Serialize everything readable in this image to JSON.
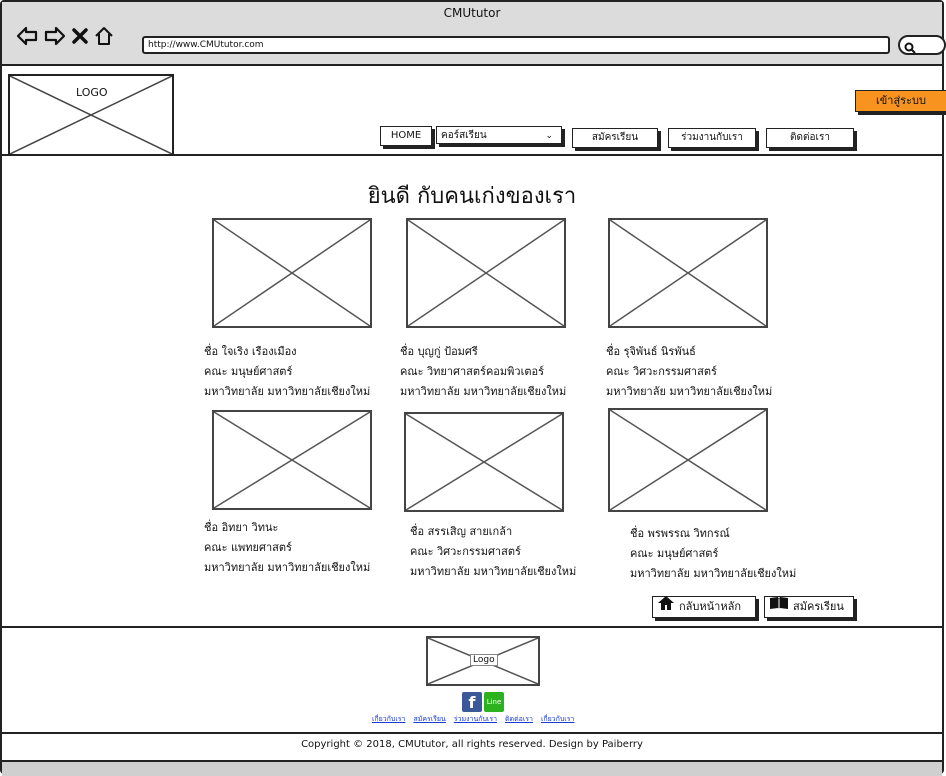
{
  "window": {
    "title": "CMUtutor",
    "url": "http://www.CMUtutor.com"
  },
  "header": {
    "logo_label": "LOGO",
    "login_label": "เข้าสู่ระบบ",
    "menu": {
      "home": "HOME",
      "courses": "คอร์สเรียน",
      "register": "สมัครเรียน",
      "join": "ร่วมงานกับเรา",
      "contact": "ติดต่อเรา"
    }
  },
  "main": {
    "heading": "ยินดี กับคนเก่งของเรา",
    "people": [
      {
        "name": "ชื่อ ใจเริง เรืองเมือง",
        "faculty": "คณะ มนุษย์ศาสตร์",
        "university": "มหาวิทยาลัย มหาวิทยาลัยเชียงใหม่"
      },
      {
        "name": "ชื่อ บุญกู่ ป้อมศรี",
        "faculty": "คณะ วิทยาศาสตร์คอมพิวเตอร์",
        "university": "มหาวิทยาลัย มหาวิทยาลัยเชียงใหม่"
      },
      {
        "name": "ชื่อ รุจิพันธ์ นิรพันธ์",
        "faculty": "คณะ วิศวะกรรมศาสตร์",
        "university": "มหาวิทยาลัย มหาวิทยาลัยเชียงใหม่"
      },
      {
        "name": "ชื่อ อิทยา วิทนะ",
        "faculty": "คณะ แพทยศาสตร์",
        "university": "มหาวิทยาลัย มหาวิทยาลัยเชียงใหม่"
      },
      {
        "name": "ชื่อ สรรเสิญ สายเกล้า",
        "faculty": "คณะ วิศวะกรรมศาสตร์",
        "university": "มหาวิทยาลัย มหาวิทยาลัยเชียงใหม่"
      },
      {
        "name": "ชื่อ พรพรรณ วิทกรณ์",
        "faculty": "คณะ มนุษย์ศาสตร์",
        "university": "มหาวิทยาลัย มหาวิทยาลัยเชียงใหม่"
      }
    ],
    "back_home_label": "กลับหน้าหลัก",
    "register_label": "สมัครเรียน"
  },
  "footer": {
    "logo_label": "Logo",
    "facebook_icon": "f",
    "line_icon": "Line",
    "links": [
      "เกี่ยวกับเรา",
      "สมัครเรียน",
      "ร่วมงานกับเรา",
      "ติดต่อเรา",
      "เกี่ยวกับเรา"
    ],
    "copyright": "Copyright © 2018, CMUtutor, all rights reserved. Design by Paiberry"
  },
  "colors": {
    "login_button": "#f7931e",
    "facebook": "#3b5998",
    "line": "#2bb21e",
    "link": "#1a3bd1"
  }
}
